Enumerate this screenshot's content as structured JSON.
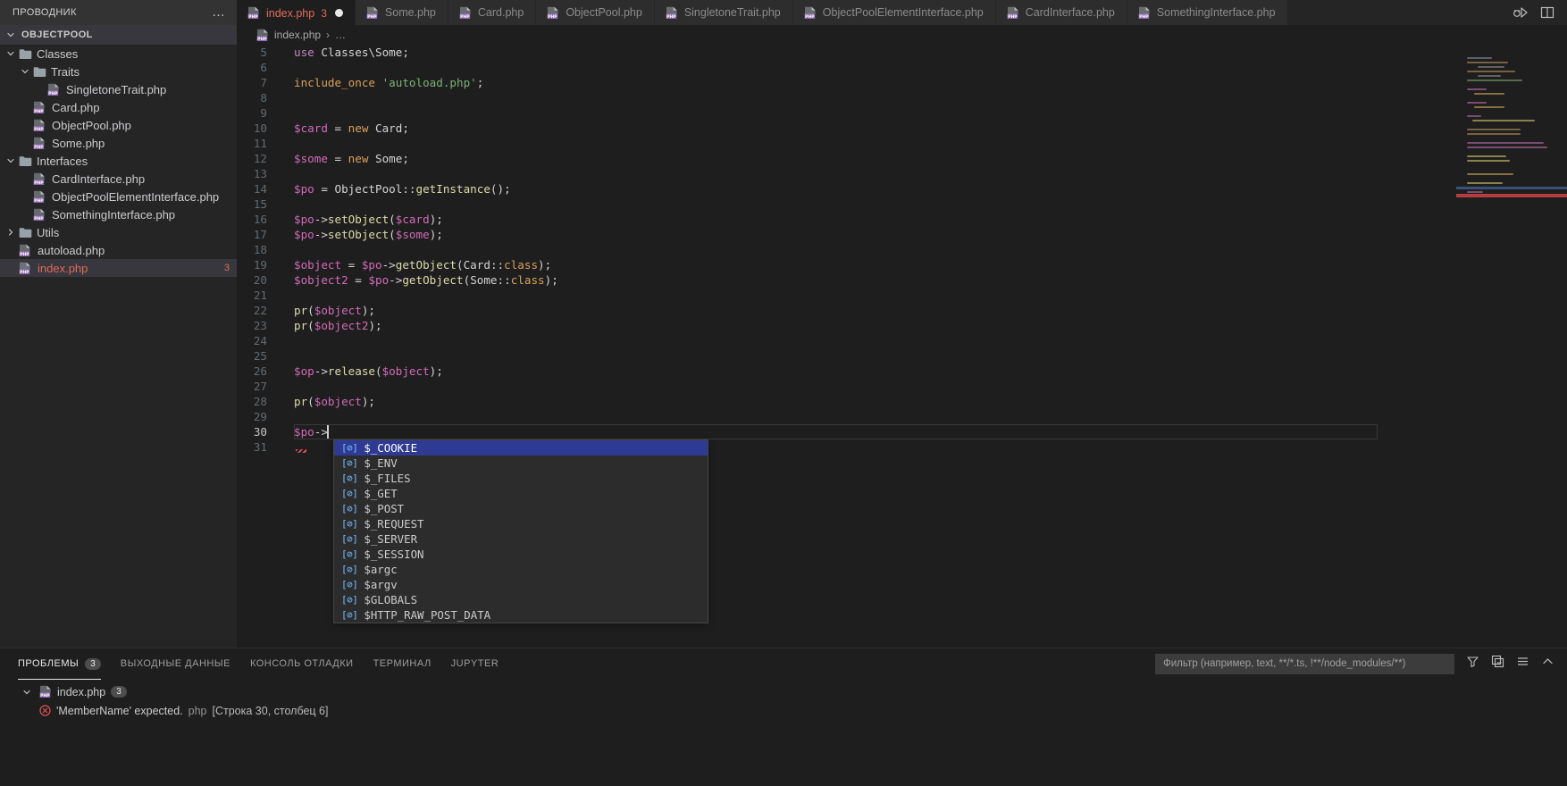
{
  "sidebar": {
    "title": "ПРОВОДНИК",
    "more_label": "…",
    "root": "OBJECTPOOL",
    "items": [
      {
        "label": "Classes",
        "type": "folder",
        "indent": 1,
        "expanded": true
      },
      {
        "label": "Traits",
        "type": "folder",
        "indent": 2,
        "expanded": true
      },
      {
        "label": "SingletoneTrait.php",
        "type": "php",
        "indent": 3
      },
      {
        "label": "Card.php",
        "type": "php",
        "indent": 2
      },
      {
        "label": "ObjectPool.php",
        "type": "php",
        "indent": 2
      },
      {
        "label": "Some.php",
        "type": "php",
        "indent": 2
      },
      {
        "label": "Interfaces",
        "type": "folder",
        "indent": 1,
        "expanded": true
      },
      {
        "label": "CardInterface.php",
        "type": "php",
        "indent": 2
      },
      {
        "label": "ObjectPoolElementInterface.php",
        "type": "php",
        "indent": 2
      },
      {
        "label": "SomethingInterface.php",
        "type": "php",
        "indent": 2
      },
      {
        "label": "Utils",
        "type": "folder",
        "indent": 1,
        "expanded": false
      },
      {
        "label": "autoload.php",
        "type": "php",
        "indent": 1
      },
      {
        "label": "index.php",
        "type": "php",
        "indent": 1,
        "error": true,
        "selected": true,
        "badge": "3"
      }
    ]
  },
  "tabs": [
    {
      "label": "index.php",
      "active": true,
      "error_count": "3",
      "dirty": true
    },
    {
      "label": "Some.php"
    },
    {
      "label": "Card.php"
    },
    {
      "label": "ObjectPool.php"
    },
    {
      "label": "SingletoneTrait.php"
    },
    {
      "label": "ObjectPoolElementInterface.php"
    },
    {
      "label": "CardInterface.php"
    },
    {
      "label": "SomethingInterface.php"
    }
  ],
  "tab_actions": [
    {
      "icon": "run-and-debug-icon"
    },
    {
      "icon": "split-editor-icon"
    }
  ],
  "breadcrumb": {
    "file": "index.php",
    "separator": "›",
    "trail": "…"
  },
  "editor": {
    "first_line": 5,
    "cursor_line": 30,
    "lines": [
      {
        "n": 5,
        "tokens": [
          {
            "t": "use ",
            "c": "k-kw"
          },
          {
            "t": "Classes\\Some;",
            "c": "k-cls"
          }
        ]
      },
      {
        "n": 6,
        "tokens": []
      },
      {
        "n": 7,
        "tokens": [
          {
            "t": "include_once ",
            "c": "k-inc"
          },
          {
            "t": "'autoload.php'",
            "c": "k-str"
          },
          {
            "t": ";",
            "c": "k-op"
          }
        ]
      },
      {
        "n": 8,
        "tokens": []
      },
      {
        "n": 9,
        "tokens": []
      },
      {
        "n": 10,
        "tokens": [
          {
            "t": "$card",
            "c": "k-var"
          },
          {
            "t": " = ",
            "c": "k-op"
          },
          {
            "t": "new",
            "c": "k-new"
          },
          {
            "t": " Card;",
            "c": "k-cls"
          }
        ]
      },
      {
        "n": 11,
        "tokens": []
      },
      {
        "n": 12,
        "tokens": [
          {
            "t": "$some",
            "c": "k-var"
          },
          {
            "t": " = ",
            "c": "k-op"
          },
          {
            "t": "new",
            "c": "k-new"
          },
          {
            "t": " Some;",
            "c": "k-cls"
          }
        ]
      },
      {
        "n": 13,
        "tokens": []
      },
      {
        "n": 14,
        "tokens": [
          {
            "t": "$po",
            "c": "k-var"
          },
          {
            "t": " = ",
            "c": "k-op"
          },
          {
            "t": "ObjectPool",
            "c": "k-cls"
          },
          {
            "t": "::",
            "c": "k-op"
          },
          {
            "t": "getInstance",
            "c": "k-fn"
          },
          {
            "t": "();",
            "c": "k-op"
          }
        ]
      },
      {
        "n": 15,
        "tokens": []
      },
      {
        "n": 16,
        "tokens": [
          {
            "t": "$po",
            "c": "k-var"
          },
          {
            "t": "->",
            "c": "k-op"
          },
          {
            "t": "setObject",
            "c": "k-fn"
          },
          {
            "t": "(",
            "c": "k-op"
          },
          {
            "t": "$card",
            "c": "k-var"
          },
          {
            "t": ");",
            "c": "k-op"
          }
        ]
      },
      {
        "n": 17,
        "tokens": [
          {
            "t": "$po",
            "c": "k-var"
          },
          {
            "t": "->",
            "c": "k-op"
          },
          {
            "t": "setObject",
            "c": "k-fn"
          },
          {
            "t": "(",
            "c": "k-op"
          },
          {
            "t": "$some",
            "c": "k-var"
          },
          {
            "t": ");",
            "c": "k-op"
          }
        ]
      },
      {
        "n": 18,
        "tokens": []
      },
      {
        "n": 19,
        "tokens": [
          {
            "t": "$object",
            "c": "k-var"
          },
          {
            "t": " = ",
            "c": "k-op"
          },
          {
            "t": "$po",
            "c": "k-var"
          },
          {
            "t": "->",
            "c": "k-op"
          },
          {
            "t": "getObject",
            "c": "k-fn"
          },
          {
            "t": "(",
            "c": "k-op"
          },
          {
            "t": "Card",
            "c": "k-cls"
          },
          {
            "t": "::",
            "c": "k-op"
          },
          {
            "t": "class",
            "c": "k-const"
          },
          {
            "t": ");",
            "c": "k-op"
          }
        ]
      },
      {
        "n": 20,
        "tokens": [
          {
            "t": "$object2",
            "c": "k-var"
          },
          {
            "t": " = ",
            "c": "k-op"
          },
          {
            "t": "$po",
            "c": "k-var"
          },
          {
            "t": "->",
            "c": "k-op"
          },
          {
            "t": "getObject",
            "c": "k-fn"
          },
          {
            "t": "(",
            "c": "k-op"
          },
          {
            "t": "Some",
            "c": "k-cls"
          },
          {
            "t": "::",
            "c": "k-op"
          },
          {
            "t": "class",
            "c": "k-const"
          },
          {
            "t": ");",
            "c": "k-op"
          }
        ]
      },
      {
        "n": 21,
        "tokens": []
      },
      {
        "n": 22,
        "tokens": [
          {
            "t": "pr",
            "c": "k-fn"
          },
          {
            "t": "(",
            "c": "k-op"
          },
          {
            "t": "$object",
            "c": "k-var"
          },
          {
            "t": ");",
            "c": "k-op"
          }
        ]
      },
      {
        "n": 23,
        "tokens": [
          {
            "t": "pr",
            "c": "k-fn"
          },
          {
            "t": "(",
            "c": "k-op"
          },
          {
            "t": "$object2",
            "c": "k-var"
          },
          {
            "t": ");",
            "c": "k-op"
          }
        ]
      },
      {
        "n": 24,
        "tokens": []
      },
      {
        "n": 25,
        "tokens": []
      },
      {
        "n": 26,
        "tokens": [
          {
            "t": "$op",
            "c": "k-var"
          },
          {
            "t": "->",
            "c": "k-op"
          },
          {
            "t": "release",
            "c": "k-fn"
          },
          {
            "t": "(",
            "c": "k-op"
          },
          {
            "t": "$object",
            "c": "k-var"
          },
          {
            "t": ");",
            "c": "k-op"
          }
        ]
      },
      {
        "n": 27,
        "tokens": []
      },
      {
        "n": 28,
        "tokens": [
          {
            "t": "pr",
            "c": "k-fn"
          },
          {
            "t": "(",
            "c": "k-op"
          },
          {
            "t": "$object",
            "c": "k-var"
          },
          {
            "t": ");",
            "c": "k-op"
          }
        ]
      },
      {
        "n": 29,
        "tokens": []
      },
      {
        "n": 30,
        "tokens": [
          {
            "t": "$po",
            "c": "k-var"
          },
          {
            "t": "->",
            "c": "k-op"
          }
        ],
        "cursor": true
      },
      {
        "n": 31,
        "tokens": []
      }
    ]
  },
  "autocomplete": {
    "items": [
      {
        "label": "$_COOKIE",
        "selected": true
      },
      {
        "label": "$_ENV"
      },
      {
        "label": "$_FILES"
      },
      {
        "label": "$_GET"
      },
      {
        "label": "$_POST"
      },
      {
        "label": "$_REQUEST"
      },
      {
        "label": "$_SERVER"
      },
      {
        "label": "$_SESSION"
      },
      {
        "label": "$argc"
      },
      {
        "label": "$argv"
      },
      {
        "label": "$GLOBALS"
      },
      {
        "label": "$HTTP_RAW_POST_DATA"
      }
    ]
  },
  "panel": {
    "tabs": [
      {
        "label": "ПРОБЛЕМЫ",
        "count": "3",
        "active": true
      },
      {
        "label": "ВЫХОДНЫЕ ДАННЫЕ"
      },
      {
        "label": "КОНСОЛЬ ОТЛАДКИ"
      },
      {
        "label": "ТЕРМИНАЛ"
      },
      {
        "label": "JUPYTER"
      }
    ],
    "filter": {
      "value": "",
      "placeholder": "Фильтр (например, text, **/*.ts, !**/node_modules/**)"
    },
    "actions": [
      {
        "icon": "filter-icon"
      },
      {
        "icon": "collapse-all-icon"
      },
      {
        "icon": "panel-menu-icon"
      },
      {
        "icon": "chevron-up-icon"
      }
    ],
    "problems": {
      "file": "index.php",
      "count": "3",
      "items": [
        {
          "message": "'MemberName' expected.",
          "source": "php",
          "location": "[Строка 30, столбец 6]"
        }
      ]
    }
  },
  "colors": {
    "accent_error": "#e06c5a",
    "selection_blue": "#2f3b93",
    "php_icon": "#8e6bb0",
    "editor_bg": "#1e1e1e",
    "sidebar_bg": "#252526"
  }
}
